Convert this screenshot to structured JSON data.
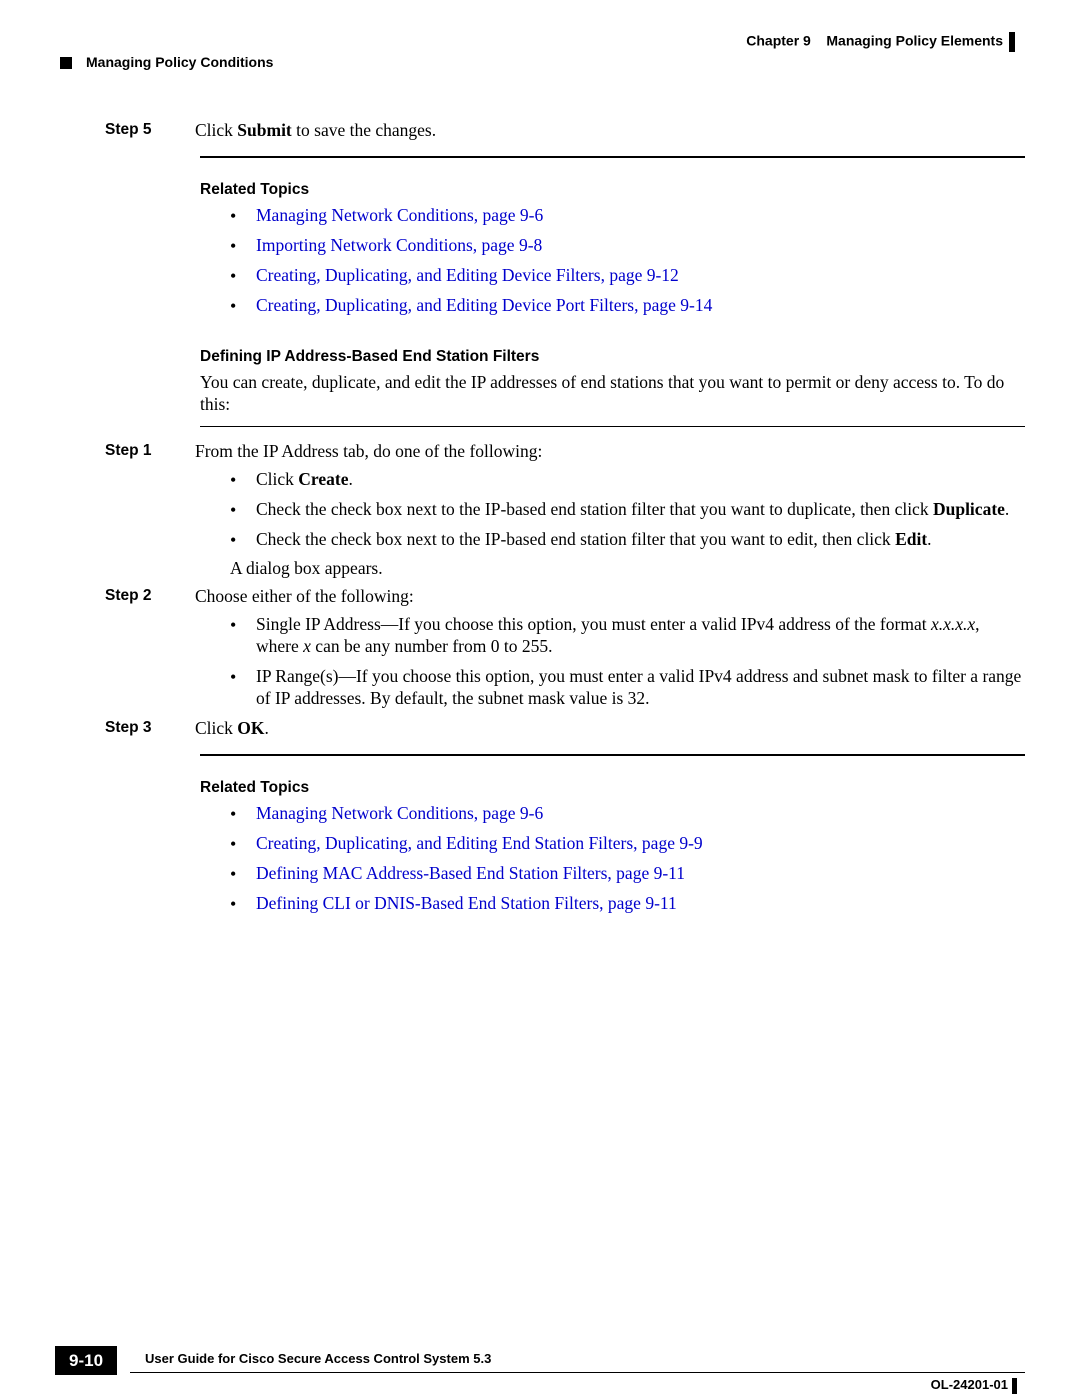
{
  "header": {
    "chapter_label": "Chapter 9",
    "chapter_title": "Managing Policy Elements",
    "section_title": "Managing Policy Conditions"
  },
  "step5": {
    "label": "Step 5",
    "text_prefix": "Click ",
    "text_bold": "Submit",
    "text_suffix": " to save the changes."
  },
  "related_topics_1": {
    "heading": "Related Topics",
    "items": [
      "Managing Network Conditions, page 9-6",
      "Importing Network Conditions, page 9-8",
      "Creating, Duplicating, and Editing Device Filters, page 9-12",
      "Creating, Duplicating, and Editing Device Port Filters, page 9-14"
    ]
  },
  "defining_heading": "Defining IP Address-Based End Station Filters",
  "defining_body": "You can create, duplicate, and edit the IP addresses of end stations that you want to permit or deny access to. To do this:",
  "step1": {
    "label": "Step 1",
    "text": "From the IP Address tab, do one of the following:",
    "bullets": {
      "b1_prefix": "Click ",
      "b1_bold": "Create",
      "b1_suffix": ".",
      "b2_prefix": "Check the check box next to the IP-based end station filter that you want to duplicate, then click ",
      "b2_bold": "Duplicate",
      "b2_suffix": ".",
      "b3_prefix": "Check the check box next to the IP-based end station filter that you want to edit, then click ",
      "b3_bold": "Edit",
      "b3_suffix": "."
    },
    "trailing": "A dialog box appears."
  },
  "step2": {
    "label": "Step 2",
    "text": "Choose either of the following:",
    "bullets": {
      "b1_prefix": "Single IP Address—If you choose this option, you must enter a valid IPv4 address of the format ",
      "b1_italic": "x.x.x.x",
      "b1_mid": ", where ",
      "b1_italic2": "x",
      "b1_suffix": " can be any number from 0 to 255.",
      "b2": "IP Range(s)—If you choose this option, you must enter a valid IPv4 address and subnet mask to filter a range of IP addresses. By default, the subnet mask value is 32."
    }
  },
  "step3": {
    "label": "Step 3",
    "text_prefix": "Click ",
    "text_bold": "OK",
    "text_suffix": "."
  },
  "related_topics_2": {
    "heading": "Related Topics",
    "items": [
      "Managing Network Conditions, page 9-6",
      "Creating, Duplicating, and Editing End Station Filters, page 9-9",
      "Defining MAC Address-Based End Station Filters, page 9-11",
      "Defining CLI or DNIS-Based End Station Filters, page 9-11"
    ]
  },
  "footer": {
    "guide_title": "User Guide for Cisco Secure Access Control System 5.3",
    "page_number": "9-10",
    "doc_id": "OL-24201-01"
  }
}
